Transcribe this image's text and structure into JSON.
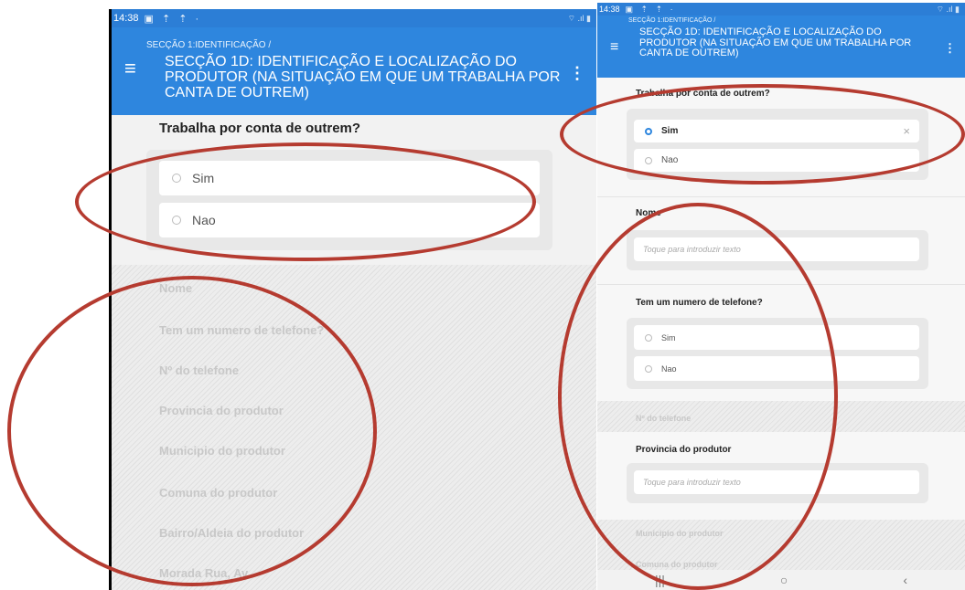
{
  "left": {
    "time": "14:38",
    "status_icons": "▣ ⇡ ⇡ ·",
    "signal": "⌔ .ıl ▮",
    "breadcrumb": "SECÇÃO 1:IDENTIFICAÇÃO /",
    "title": "SECÇÃO 1D: IDENTIFICAÇÃO E LOCALIZAÇÃO DO PRODUTOR (NA SITUAÇÃO EM QUE UM TRABALHA POR CANTA DE OUTREM)",
    "question": "Trabalha por conta de outrem?",
    "options": [
      "Sim",
      "Nao"
    ],
    "disabled_fields": [
      "Nome",
      "Tem um numero de telefone?",
      "Nº do telefone",
      "Provincia do produtor",
      "Municipio do produtor",
      "Comuna do produtor",
      "Bairro/Aldeia do produtor",
      "Morada Rua, Av."
    ]
  },
  "right": {
    "time": "14:38",
    "status_icons": "▣ ⇡ ⇡ ·",
    "signal": "⌔ .ıl ▮",
    "breadcrumb": "SECÇÃO 1:IDENTIFICAÇÃO /",
    "title": "SECÇÃO 1D: IDENTIFICAÇÃO E LOCALIZAÇÃO DO PRODUTOR (NA SITUAÇÃO EM QUE UM TRABALHA POR CANTA DE OUTREM)",
    "question": "Trabalha por conta de outrem?",
    "options": [
      "Sim",
      "Nao"
    ],
    "clear_symbol": "×",
    "nome_label": "Nome",
    "text_placeholder": "Toque para introduzir texto",
    "phone_question": "Tem um numero de telefone?",
    "phone_options": [
      "Sim",
      "Nao"
    ],
    "phone_number_label": "Nº do telefone",
    "provincia_label": "Provincia do produtor",
    "municipio_label": "Municipio do produtor",
    "comuna_label": "Comuna do produtor",
    "nav": [
      "|||",
      "○",
      "‹"
    ]
  },
  "colors": {
    "appbar": "#2e86de",
    "annotation": "#b53b30",
    "selected_radio": "#2e86de"
  }
}
